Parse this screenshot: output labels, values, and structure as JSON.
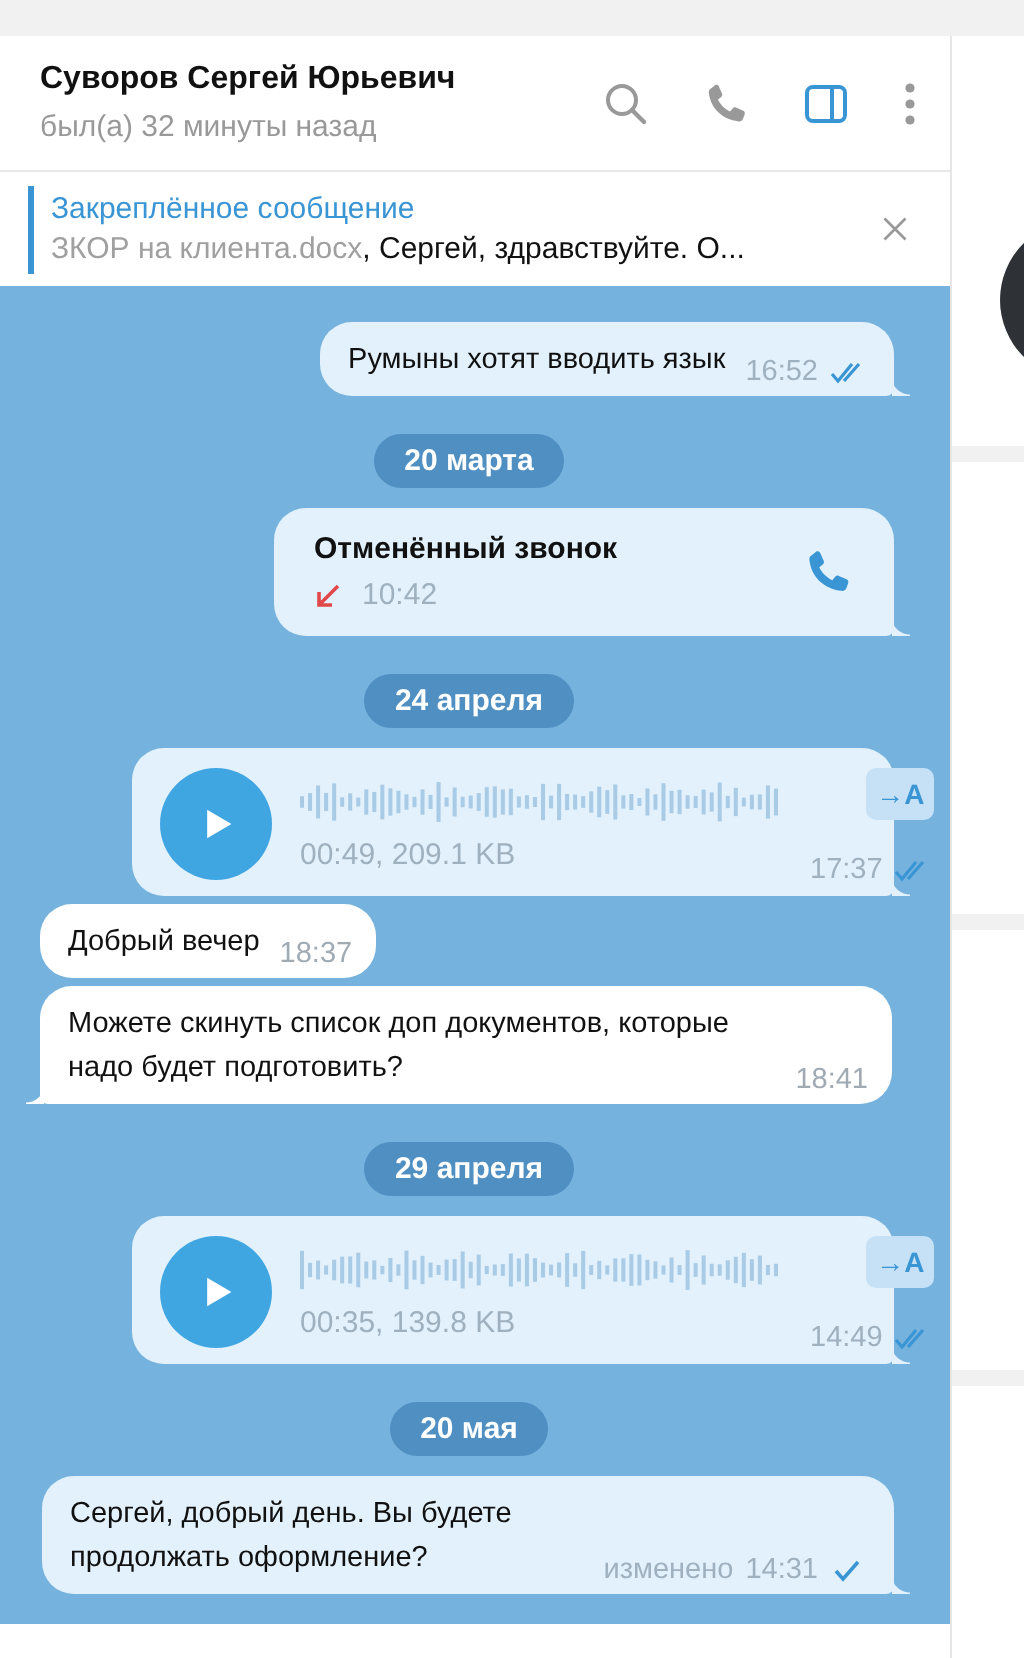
{
  "header": {
    "name": "Суворов Сергей Юрьевич",
    "status": "был(а) 32 минуты назад",
    "actions": [
      {
        "kind": "search",
        "active": false
      },
      {
        "kind": "call",
        "active": false
      },
      {
        "kind": "panel",
        "active": true
      },
      {
        "kind": "more",
        "active": false
      }
    ]
  },
  "pinned": {
    "title": "Закреплённое сообщение",
    "attachment": "ЗКОР на клиента.docx",
    "text": ", Сергей, здравствуйте. О..."
  },
  "messages": [
    {
      "kind": "text",
      "outgoing": true,
      "tail": true,
      "text": "Румыны хотят вводить язык",
      "time": "16:52",
      "read": true
    },
    {
      "kind": "date",
      "text": "20 марта"
    },
    {
      "kind": "call",
      "outgoing": true,
      "tail": true,
      "title": "Отменённый звонок",
      "time": "10:42",
      "missed": true
    },
    {
      "kind": "date",
      "text": "24 апреля"
    },
    {
      "kind": "voice",
      "outgoing": true,
      "tail": true,
      "info": "00:49, 209.1 KB",
      "transcribe": "→A",
      "time": "17:37",
      "read": true
    },
    {
      "kind": "text",
      "outgoing": false,
      "tail": false,
      "text": "Добрый вечер",
      "time": "18:37"
    },
    {
      "kind": "text",
      "outgoing": false,
      "tail": true,
      "text": "Можете скинуть список доп документов, которые надо будет подготовить?",
      "time": "18:41"
    },
    {
      "kind": "date",
      "text": "29 апреля"
    },
    {
      "kind": "voice",
      "outgoing": true,
      "tail": true,
      "info": "00:35, 139.8 KB",
      "transcribe": "→A",
      "time": "14:49",
      "read": true
    },
    {
      "kind": "date",
      "text": "20 мая"
    },
    {
      "kind": "text",
      "outgoing": true,
      "tail": true,
      "text": "Сергей, добрый день. Вы будете продолжать оформление?",
      "edited": "изменено",
      "time": "14:31",
      "read": false
    }
  ]
}
